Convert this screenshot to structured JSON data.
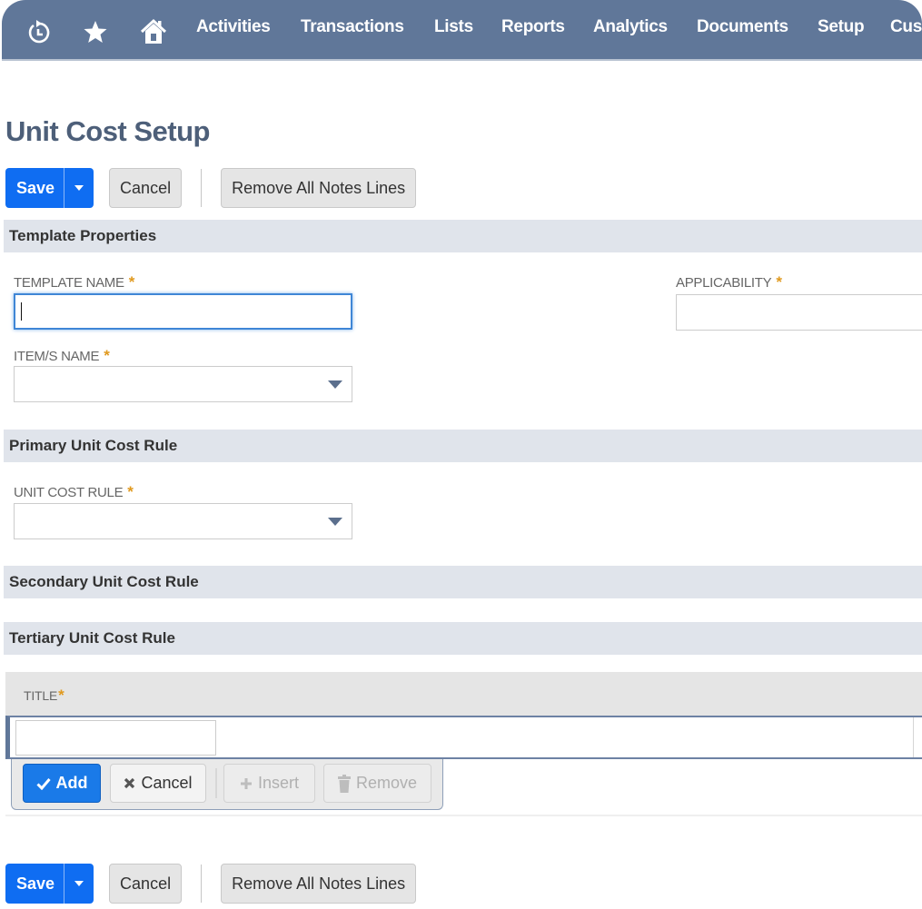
{
  "nav": {
    "icons": [
      "recent-records-icon",
      "favorites-star-icon",
      "home-icon"
    ],
    "items": [
      "Activities",
      "Transactions",
      "Lists",
      "Reports",
      "Analytics",
      "Documents",
      "Setup",
      "Cus"
    ]
  },
  "page": {
    "title": "Unit Cost Setup"
  },
  "toolbar": {
    "save_label": "Save",
    "cancel_label": "Cancel",
    "remove_notes_label": "Remove All Notes Lines"
  },
  "sections": {
    "template_properties": "Template Properties",
    "primary": "Primary Unit Cost Rule",
    "secondary": "Secondary Unit Cost Rule",
    "tertiary": "Tertiary Unit Cost Rule"
  },
  "fields": {
    "template_name": {
      "label": "TEMPLATE NAME",
      "required": "*",
      "value": ""
    },
    "applicability": {
      "label": "APPLICABILITY",
      "required": "*",
      "value": ""
    },
    "items_name": {
      "label": "ITEM/S NAME",
      "required": "*",
      "value": ""
    },
    "unit_cost_rule": {
      "label": "UNIT COST RULE",
      "required": "*",
      "value": ""
    }
  },
  "sublist": {
    "columns": [
      {
        "label": "TITLE",
        "required": "*"
      }
    ],
    "row": {
      "title_value": ""
    },
    "actions": {
      "add": "Add",
      "cancel": "Cancel",
      "insert": "Insert",
      "remove": "Remove"
    }
  },
  "colors": {
    "nav_bg": "#607799",
    "primary_button": "#0f6df2",
    "required_star": "#e0991e",
    "section_bg": "#e0e4eb",
    "title_color": "#4d5f79"
  }
}
